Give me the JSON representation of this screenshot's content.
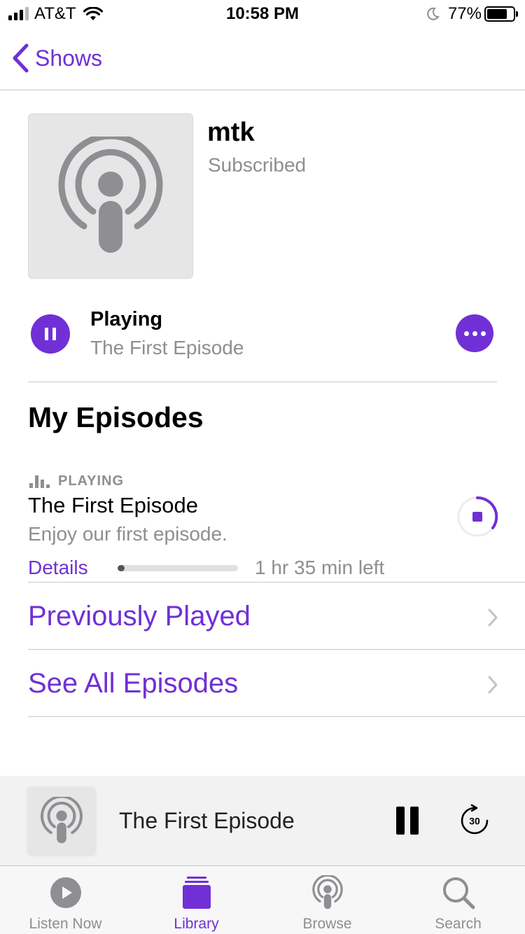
{
  "status_bar": {
    "carrier": "AT&T",
    "time": "10:58 PM",
    "battery": "77%",
    "battery_level": 0.77
  },
  "nav": {
    "back_label": "Shows"
  },
  "show": {
    "title": "mtk",
    "status": "Subscribed"
  },
  "now_playing": {
    "state": "Playing",
    "episode": "The First Episode"
  },
  "my_episodes": {
    "title": "My Episodes",
    "episodes": [
      {
        "tag": "PLAYING",
        "title": "The First Episode",
        "description": "Enjoy our first episode.",
        "details_label": "Details",
        "time_left": "1 hr 35 min left",
        "progress": 0.06
      }
    ]
  },
  "links": {
    "previously_played": "Previously Played",
    "see_all": "See All Episodes"
  },
  "mini_player": {
    "title": "The First Episode",
    "skip_seconds": "30"
  },
  "tabs": [
    {
      "label": "Listen Now",
      "icon": "play-circle-icon"
    },
    {
      "label": "Library",
      "icon": "library-stack-icon"
    },
    {
      "label": "Browse",
      "icon": "podcasts-icon"
    },
    {
      "label": "Search",
      "icon": "magnifier-icon"
    }
  ],
  "colors": {
    "accent": "#7030d6",
    "secondary_text": "#8e8e93"
  }
}
